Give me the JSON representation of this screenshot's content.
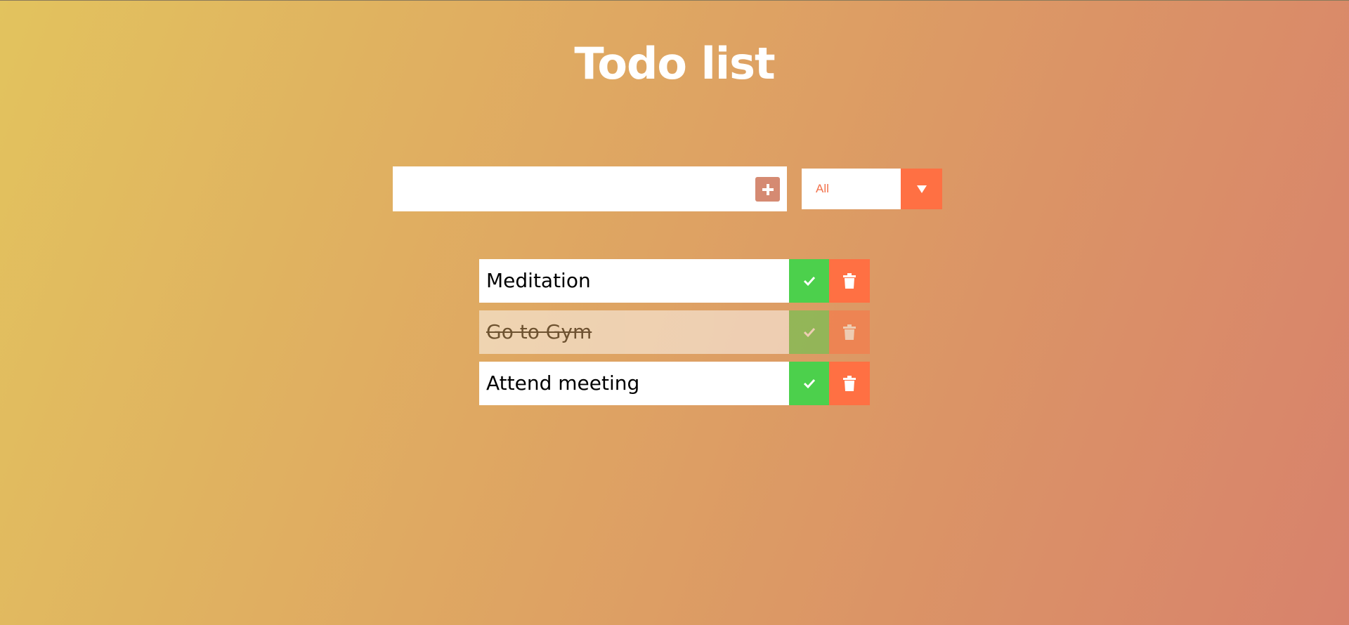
{
  "page": {
    "title": "Todo list"
  },
  "form": {
    "input_value": "",
    "add_icon": "plus-icon"
  },
  "filter": {
    "selected": "All",
    "arrow_icon": "triangle-down-icon"
  },
  "todos": [
    {
      "text": "Meditation",
      "completed": false
    },
    {
      "text": "Go to Gym",
      "completed": true
    },
    {
      "text": "Attend meeting",
      "completed": false
    }
  ],
  "colors": {
    "complete": "#4cd04c",
    "trash": "#ff7043",
    "add_button": "#d58a72",
    "filter_text": "#f2714b"
  }
}
